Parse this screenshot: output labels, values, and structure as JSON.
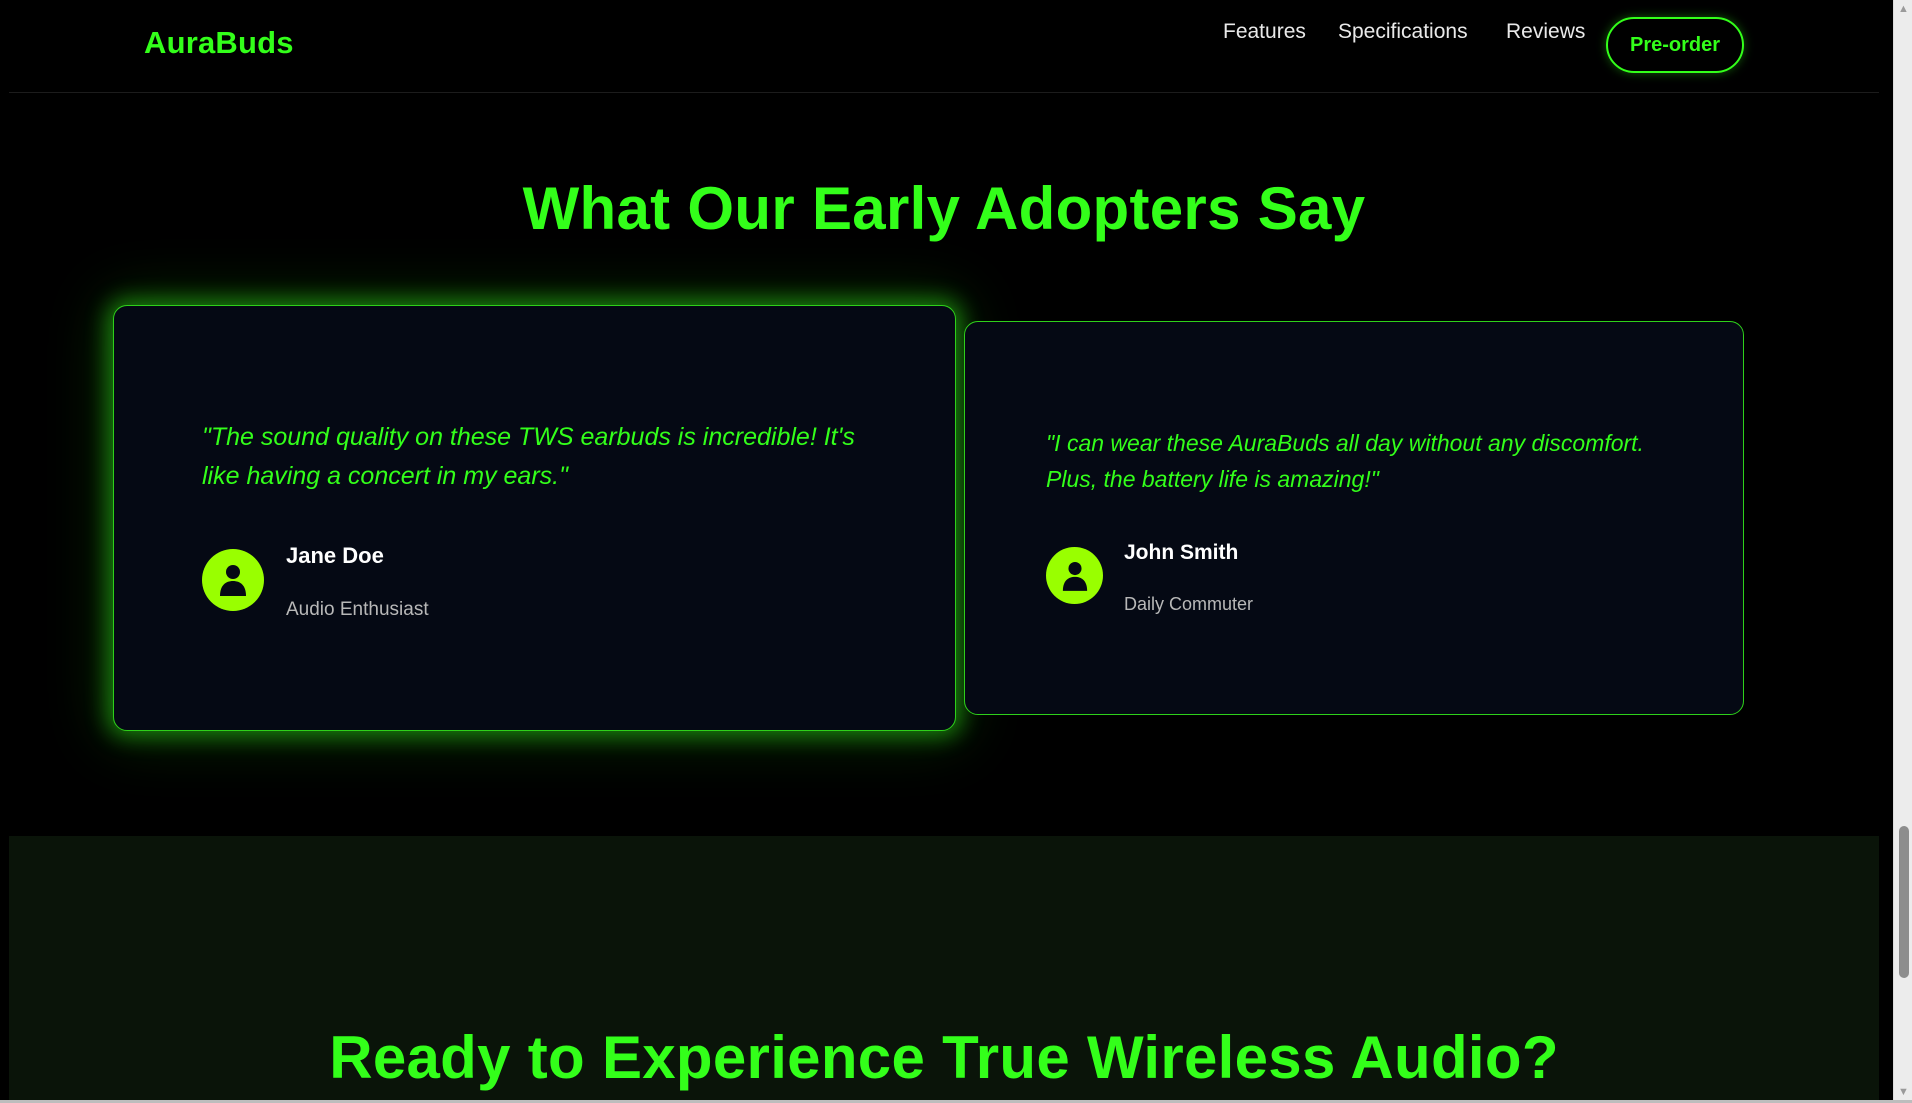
{
  "nav": {
    "brand": "AuraBuds",
    "links": [
      "Features",
      "Specifications",
      "Reviews"
    ],
    "cta": "Pre-order"
  },
  "testimonials": {
    "title": "What Our Early Adopters Say",
    "items": [
      {
        "quote": "\"The sound quality on these TWS earbuds is incredible! It's like having a concert in my ears.\"",
        "name": "Jane Doe",
        "role": "Audio Enthusiast"
      },
      {
        "quote": "\"I can wear these AuraBuds all day without any discomfort. Plus, the battery life is amazing!\"",
        "name": "John Smith",
        "role": "Daily Commuter"
      }
    ]
  },
  "cta_section": {
    "title": "Ready to Experience True Wireless Audio?"
  },
  "icons": {
    "avatar": "user-icon",
    "scroll_up": "chevron-up-icon",
    "scroll_down": "chevron-down-icon"
  },
  "colors": {
    "accent": "#33ff1a",
    "avatar_bg": "#99ff00",
    "card_bg": "#050914",
    "page_bg": "#000000",
    "cta_bg": "#0a1409"
  }
}
